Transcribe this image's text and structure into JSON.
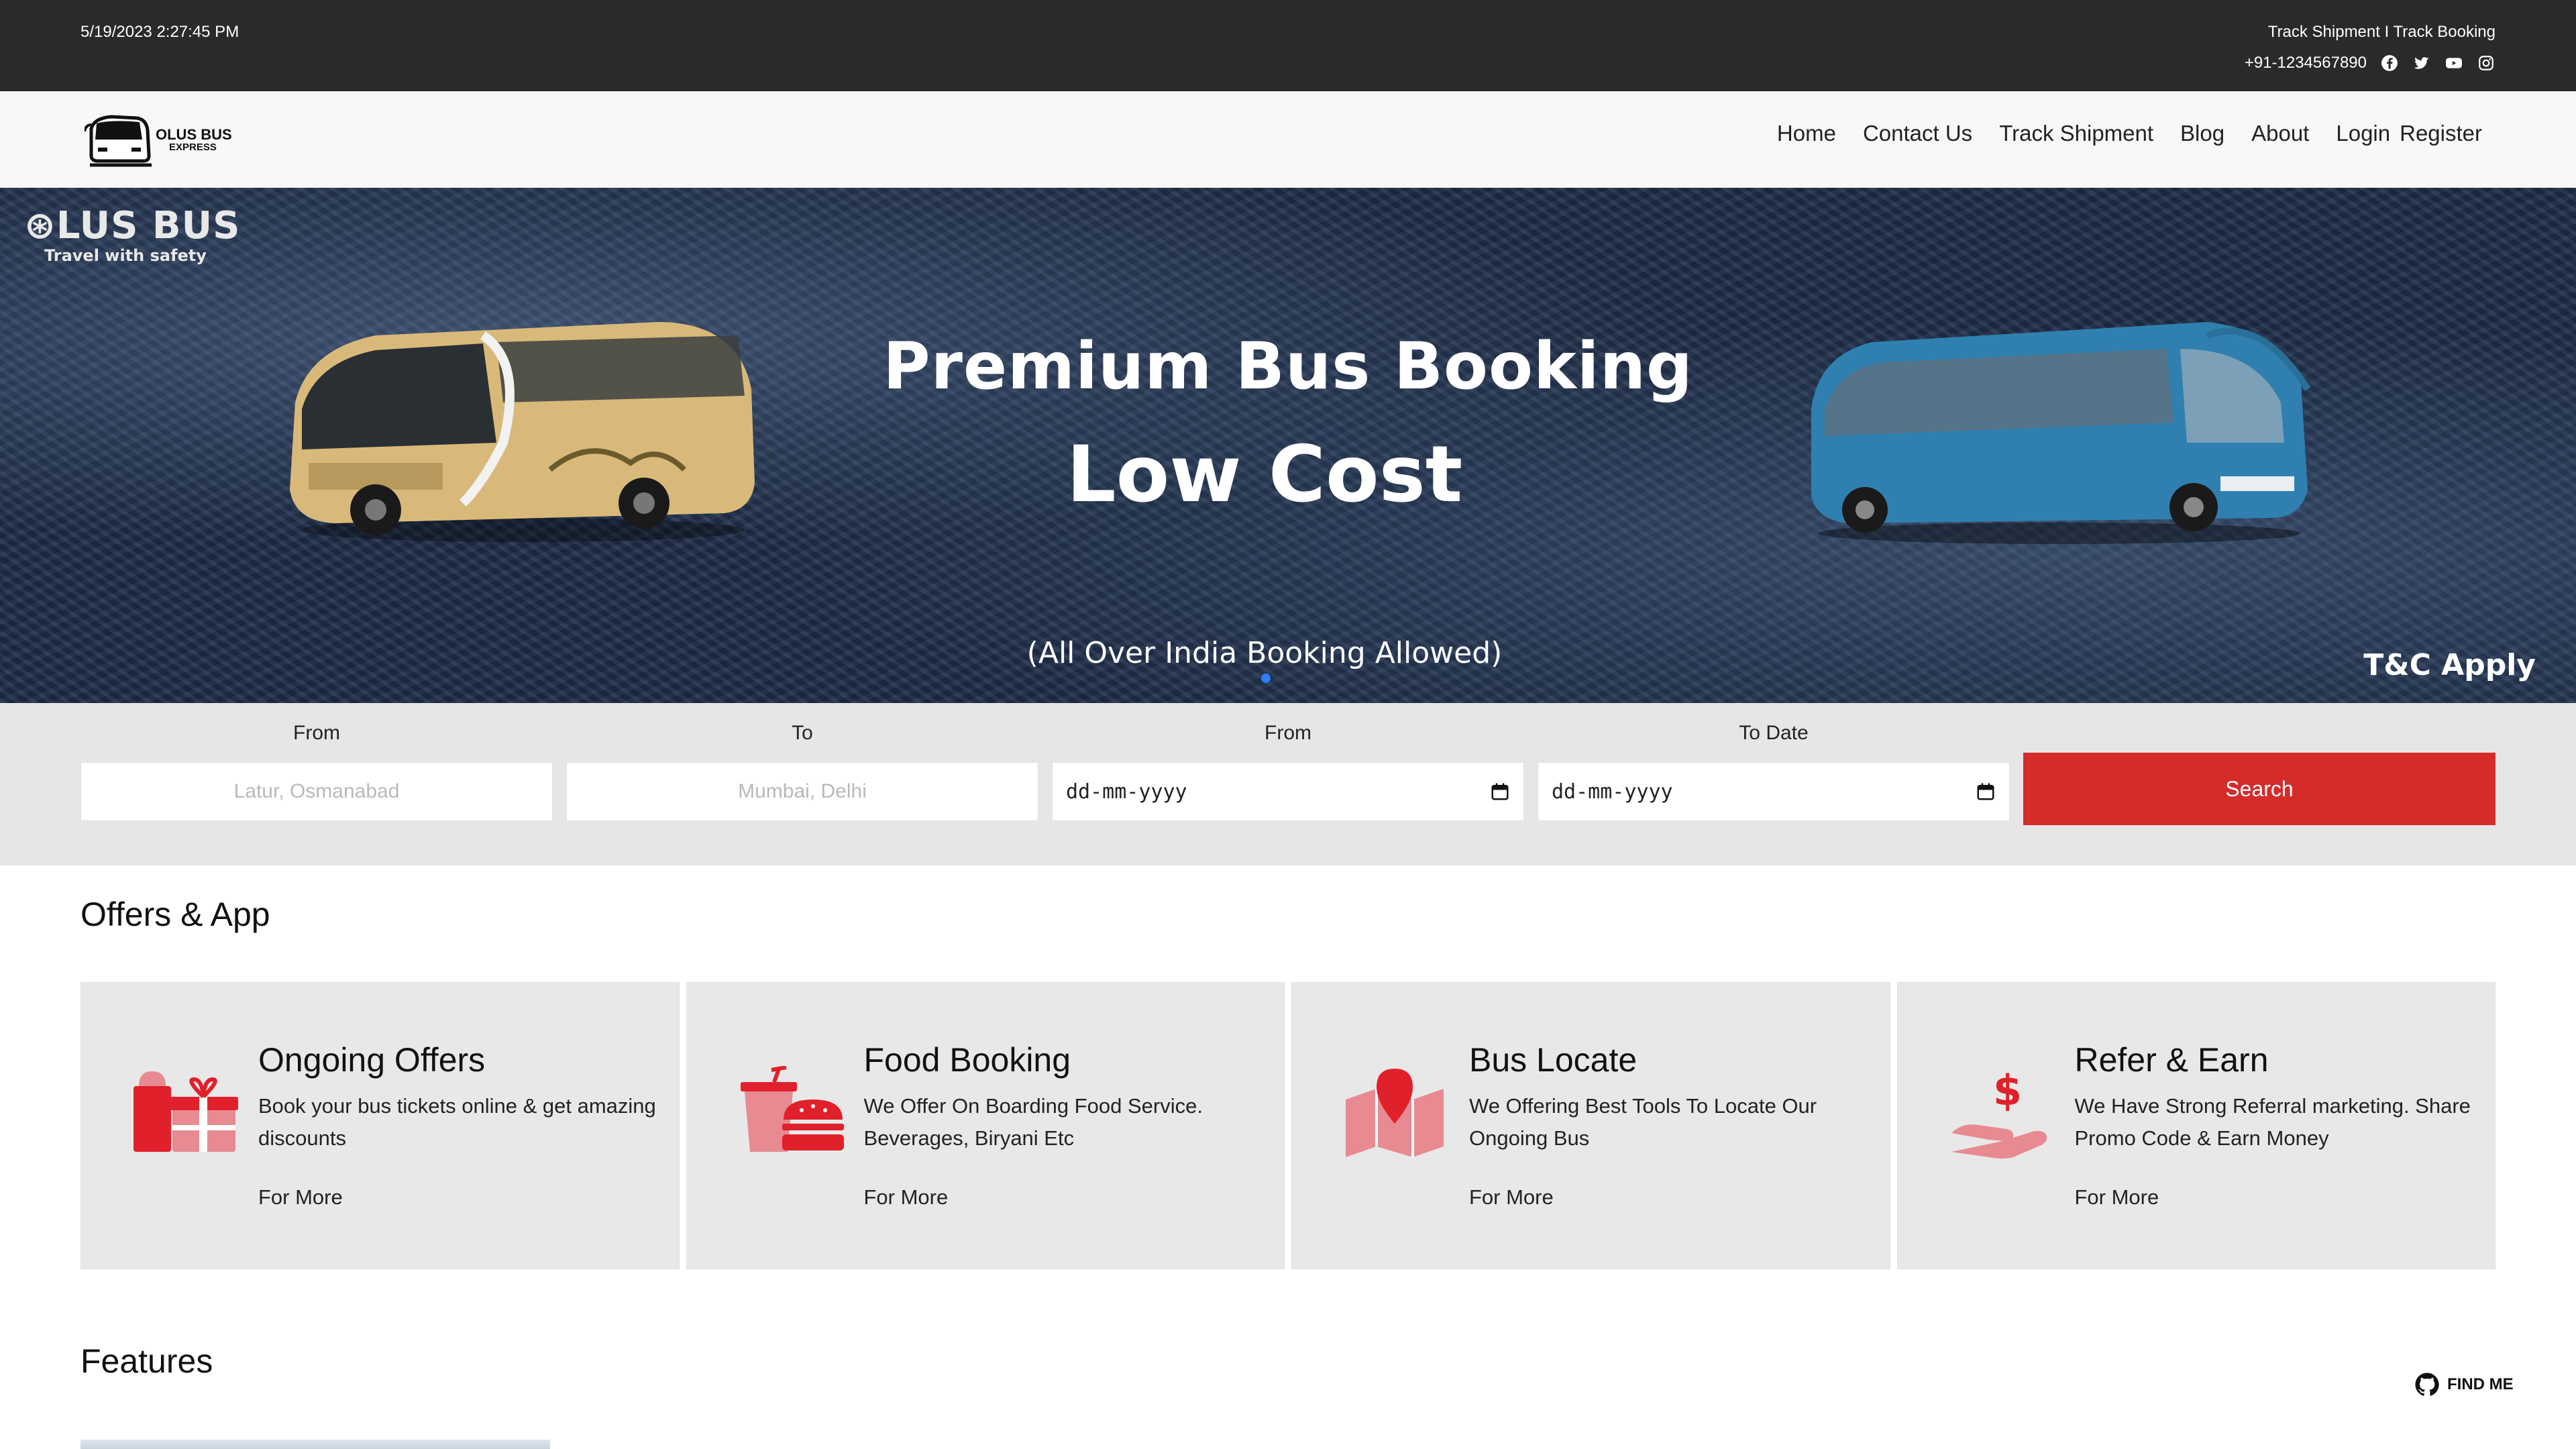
{
  "topbar": {
    "datetime": "5/19/2023 2:27:45 PM",
    "links": "Track Shipment I Track Booking",
    "phone": "+91-1234567890",
    "social": [
      "facebook-icon",
      "twitter-icon",
      "youtube-icon",
      "instagram-icon"
    ]
  },
  "navbar": {
    "brand_line1": "OLUS BUS",
    "brand_line2": "EXPRESS",
    "items": [
      "Home",
      "Contact Us",
      "Track Shipment",
      "Blog",
      "About"
    ],
    "login": "Login",
    "register": "Register"
  },
  "hero": {
    "logo_title": "⊛LUS BUS",
    "logo_tagline": "Travel with safety",
    "title": "Premium Bus Booking",
    "subtitle": "Low Cost",
    "note": "(All Over India Booking Allowed)",
    "tc": "T&C Apply"
  },
  "search": {
    "from_label": "From",
    "from_placeholder": "Latur, Osmanabad",
    "to_label": "To",
    "to_placeholder": "Mumbai, Delhi",
    "from_date_label": "From",
    "from_date_value": "dd-mm-yyyy",
    "to_date_label": "To Date",
    "to_date_value": "dd-mm-yyyy",
    "button": "Search"
  },
  "offers": {
    "title": "Offers & App",
    "cards": [
      {
        "title": "Ongoing Offers",
        "desc": "Book your bus tickets online & get amazing discounts",
        "more": "For More",
        "icon": "gift-icon"
      },
      {
        "title": "Food Booking",
        "desc": "We Offer On Boarding Food Service. Beverages, Biryani Etc",
        "more": "For More",
        "icon": "food-icon"
      },
      {
        "title": "Bus Locate",
        "desc": "We Offering Best Tools To Locate Our Ongoing Bus",
        "more": "For More",
        "icon": "map-pin-icon"
      },
      {
        "title": "Refer & Earn",
        "desc": "We Have Strong Referral marketing. Share Promo Code & Earn Money",
        "more": "For More",
        "icon": "dollar-hand-icon"
      }
    ]
  },
  "features": {
    "title": "Features"
  },
  "find_me": "FIND ME",
  "colors": {
    "topbar": "#2a2a2a",
    "accent": "#d52b2b",
    "hero_bg": "#1d2c47",
    "icon_red": "#e0202a",
    "icon_pink": "#e88a92"
  }
}
